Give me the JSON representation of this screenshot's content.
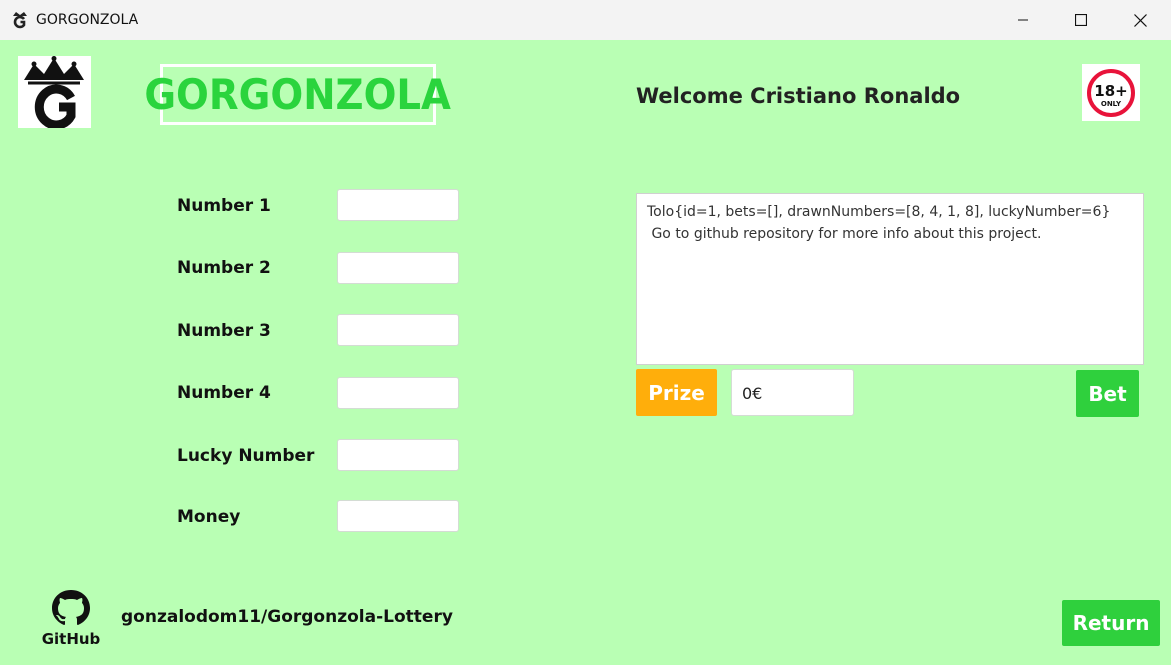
{
  "window": {
    "title": "GORGONZOLA",
    "controls": {
      "minimize_icon": "minimize-icon",
      "maximize_icon": "maximize-icon",
      "close_icon": "close-icon"
    }
  },
  "header": {
    "brand": "GORGONZOLA",
    "welcome": "Welcome Cristiano Ronaldo",
    "age_badge": {
      "main": "18+",
      "sub": "ONLY"
    }
  },
  "form": {
    "fields": [
      {
        "label": "Number 1",
        "value": ""
      },
      {
        "label": "Number 2",
        "value": ""
      },
      {
        "label": "Number 3",
        "value": ""
      },
      {
        "label": "Number 4",
        "value": ""
      },
      {
        "label": "Lucky Number",
        "value": ""
      },
      {
        "label": "Money",
        "value": ""
      }
    ]
  },
  "output": {
    "text": "Tolo{id=1, bets=[], drawnNumbers=[8, 4, 1, 8], luckyNumber=6}\n Go to github repository for more info about this project."
  },
  "prize": {
    "label": "Prize",
    "value": "0€"
  },
  "actions": {
    "bet_label": "Bet",
    "return_label": "Return"
  },
  "footer": {
    "github_label": "GitHub",
    "repo": "gonzalodom11/Gorgonzola-Lottery"
  },
  "colors": {
    "background": "#b9ffb4",
    "accent_green": "#2fd03d",
    "prize_orange": "#ffae0b"
  }
}
